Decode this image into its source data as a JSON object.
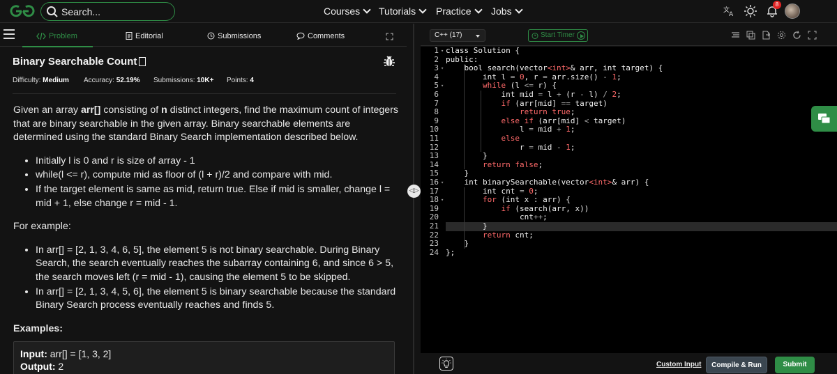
{
  "topbar": {
    "search_placeholder": "Search...",
    "nav": [
      "Courses",
      "Tutorials",
      "Practice",
      "Jobs"
    ],
    "notif_count": "8"
  },
  "tabs": {
    "problem": "Problem",
    "editorial": "Editorial",
    "submissions": "Submissions",
    "comments": "Comments"
  },
  "problem": {
    "title": "Binary Searchable Count",
    "difficulty_label": "Difficulty:",
    "difficulty": "Medium",
    "accuracy_label": "Accuracy:",
    "accuracy": "52.19%",
    "submissions_label": "Submissions:",
    "submissions": "10K+",
    "points_label": "Points:",
    "points": "4",
    "intro_1": "Given an array ",
    "intro_arr": "arr[]",
    "intro_2": " consisting of ",
    "intro_n": "n",
    "intro_3": " distinct integers, find the maximum count of integers that are binary searchable in the given array. Binary searchable elements are determined using the standard Binary Search implementation described below.",
    "bullets": [
      "Initially l is 0 and r is size of array - 1",
      "while(l <= r), compute mid as floor of (l + r)/2 and compare with mid.",
      "If the target element is same as mid, return true. Else if mid is smaller, change l = mid + 1, else change r = mid - 1."
    ],
    "for_example": "For example:",
    "examples_bullets": [
      "In arr[] = [2, 1, 3, 4, 6, 5], the element 5 is not binary searchable. During Binary Search, the search eventually reaches the subarray containing 6, and since 6 > 5, the search moves left (r = mid - 1), causing the element 5 to be skipped.",
      "In arr[] = [2, 1, 3, 4, 5, 6], the element 5 is binary searchable because the standard Binary Search process eventually reaches and finds 5."
    ],
    "examples_heading": "Examples:",
    "example_input_label": "Input:",
    "example_input": "arr[]  =  [1,  3,  2]",
    "example_output_label": "Output:",
    "example_output": "2"
  },
  "editor": {
    "language": "C++ (17)",
    "timer": "Start Timer",
    "custom_input": "Custom Input",
    "compile_run": "Compile & Run",
    "submit": "Submit",
    "line_numbers": [
      "1",
      "2",
      "3",
      "4",
      "5",
      "6",
      "7",
      "8",
      "9",
      "10",
      "11",
      "12",
      "13",
      "14",
      "15",
      "16",
      "17",
      "18",
      "19",
      "20",
      "21",
      "22",
      "23",
      "24"
    ]
  },
  "colors": {
    "accent": "#2f8d46",
    "bg": "#131313",
    "editor_bg": "#000000",
    "keyword": "#ff6a6a"
  }
}
